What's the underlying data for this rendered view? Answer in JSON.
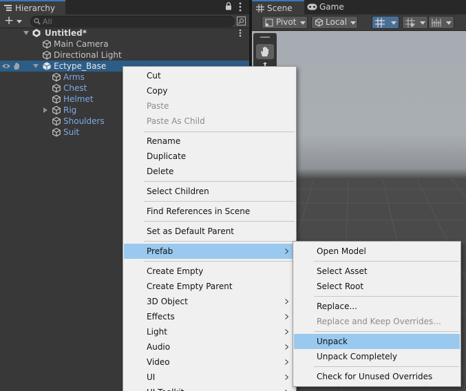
{
  "hierarchy": {
    "tab_title": "Hierarchy",
    "search_placeholder": "All",
    "scene_name": "Untitled*",
    "items": [
      {
        "label": "Main Camera"
      },
      {
        "label": "Directional Light"
      },
      {
        "label": "Ectype_Base"
      },
      {
        "label": "Arms"
      },
      {
        "label": "Chest"
      },
      {
        "label": "Helmet"
      },
      {
        "label": "Rig"
      },
      {
        "label": "Shoulders"
      },
      {
        "label": "Suit"
      }
    ]
  },
  "scene_panel": {
    "tabs": [
      {
        "label": "Scene"
      },
      {
        "label": "Game"
      }
    ],
    "pivot_label": "Pivot",
    "space_label": "Local"
  },
  "context_menu": {
    "items": [
      {
        "label": "Cut",
        "enabled": true
      },
      {
        "label": "Copy",
        "enabled": true
      },
      {
        "label": "Paste",
        "enabled": false
      },
      {
        "label": "Paste As Child",
        "enabled": false
      },
      {
        "label": "Rename",
        "enabled": true
      },
      {
        "label": "Duplicate",
        "enabled": true
      },
      {
        "label": "Delete",
        "enabled": true
      },
      {
        "label": "Select Children",
        "enabled": true
      },
      {
        "label": "Find References in Scene",
        "enabled": true
      },
      {
        "label": "Set as Default Parent",
        "enabled": true
      },
      {
        "label": "Prefab",
        "enabled": true,
        "submenu": true,
        "highlighted": true
      },
      {
        "label": "Create Empty",
        "enabled": true
      },
      {
        "label": "Create Empty Parent",
        "enabled": true
      },
      {
        "label": "3D Object",
        "enabled": true,
        "submenu": true
      },
      {
        "label": "Effects",
        "enabled": true,
        "submenu": true
      },
      {
        "label": "Light",
        "enabled": true,
        "submenu": true
      },
      {
        "label": "Audio",
        "enabled": true,
        "submenu": true
      },
      {
        "label": "Video",
        "enabled": true,
        "submenu": true
      },
      {
        "label": "UI",
        "enabled": true,
        "submenu": true
      },
      {
        "label": "UI Toolkit",
        "enabled": true,
        "submenu": true
      }
    ]
  },
  "prefab_submenu": {
    "items": [
      {
        "label": "Open Model",
        "enabled": true
      },
      {
        "label": "Select Asset",
        "enabled": true
      },
      {
        "label": "Select Root",
        "enabled": true
      },
      {
        "label": "Replace...",
        "enabled": true
      },
      {
        "label": "Replace and Keep Overrides...",
        "enabled": false
      },
      {
        "label": "Unpack",
        "enabled": true,
        "highlighted": true
      },
      {
        "label": "Unpack Completely",
        "enabled": true
      },
      {
        "label": "Check for Unused Overrides",
        "enabled": true
      }
    ]
  },
  "colors": {
    "selection": "#2c5d87",
    "menu_highlight": "#99c9ef",
    "prefab_text": "#7fa9e6"
  },
  "icons": [
    "hierarchy-icon",
    "lock-icon",
    "kebab-menu-icon",
    "plus-icon",
    "search-icon",
    "unity-scene-icon",
    "prefab-cube-icon",
    "gameobject-cube-icon",
    "visibility-eye-icon",
    "pickable-hand-icon",
    "hand-tool-icon",
    "pivot-icon",
    "local-icon",
    "grid-snap-icon",
    "submenu-arrow-icon"
  ]
}
